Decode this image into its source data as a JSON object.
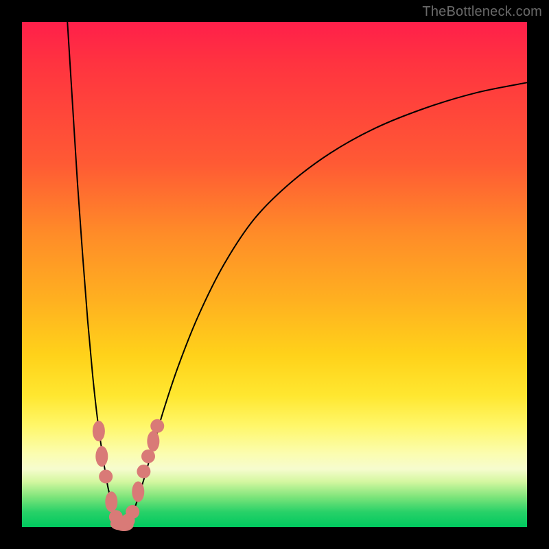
{
  "watermark": "TheBottleneck.com",
  "chart_data": {
    "type": "line",
    "title": "",
    "xlabel": "",
    "ylabel": "",
    "xlim": [
      0,
      100
    ],
    "ylim": [
      0,
      100
    ],
    "grid": false,
    "legend": false,
    "series": [
      {
        "name": "left-curve",
        "x": [
          9,
          10,
          11,
          12,
          13,
          14,
          15,
          16,
          17,
          18,
          19,
          20
        ],
        "y": [
          100,
          84,
          68,
          54,
          41,
          30,
          21,
          14,
          8,
          4,
          1,
          0
        ]
      },
      {
        "name": "right-curve",
        "x": [
          20,
          22,
          24,
          26,
          28,
          31,
          35,
          40,
          46,
          53,
          61,
          70,
          80,
          90,
          100
        ],
        "y": [
          0,
          3,
          9,
          16,
          23,
          32,
          42,
          52,
          61,
          68,
          74,
          79,
          83,
          86,
          88
        ]
      }
    ],
    "markers": [
      {
        "series": "left-curve",
        "x": 15.2,
        "y": 19,
        "shape": "oval-v"
      },
      {
        "series": "left-curve",
        "x": 15.8,
        "y": 14,
        "shape": "oval-v"
      },
      {
        "series": "left-curve",
        "x": 16.6,
        "y": 10,
        "shape": "circle"
      },
      {
        "series": "left-curve",
        "x": 17.7,
        "y": 5,
        "shape": "oval-v"
      },
      {
        "series": "left-curve",
        "x": 18.6,
        "y": 2,
        "shape": "circle"
      },
      {
        "series": "left-curve",
        "x": 19.4,
        "y": 0.6,
        "shape": "oval-h"
      },
      {
        "series": "right-curve",
        "x": 20.2,
        "y": 0.4,
        "shape": "oval-h"
      },
      {
        "series": "right-curve",
        "x": 21.0,
        "y": 1.3,
        "shape": "circle"
      },
      {
        "series": "right-curve",
        "x": 21.9,
        "y": 3,
        "shape": "circle"
      },
      {
        "series": "right-curve",
        "x": 23.0,
        "y": 7,
        "shape": "oval-v"
      },
      {
        "series": "right-curve",
        "x": 24.1,
        "y": 11,
        "shape": "circle"
      },
      {
        "series": "right-curve",
        "x": 25.0,
        "y": 14,
        "shape": "circle"
      },
      {
        "series": "right-curve",
        "x": 26.0,
        "y": 17,
        "shape": "oval-v"
      },
      {
        "series": "right-curve",
        "x": 26.8,
        "y": 20,
        "shape": "circle"
      }
    ],
    "gradient_bands": [
      {
        "color": "#ff1f4a",
        "stop_pct": 0
      },
      {
        "color": "#ffb020",
        "stop_pct": 55
      },
      {
        "color": "#fff76a",
        "stop_pct": 80
      },
      {
        "color": "#00c95f",
        "stop_pct": 100
      }
    ]
  }
}
